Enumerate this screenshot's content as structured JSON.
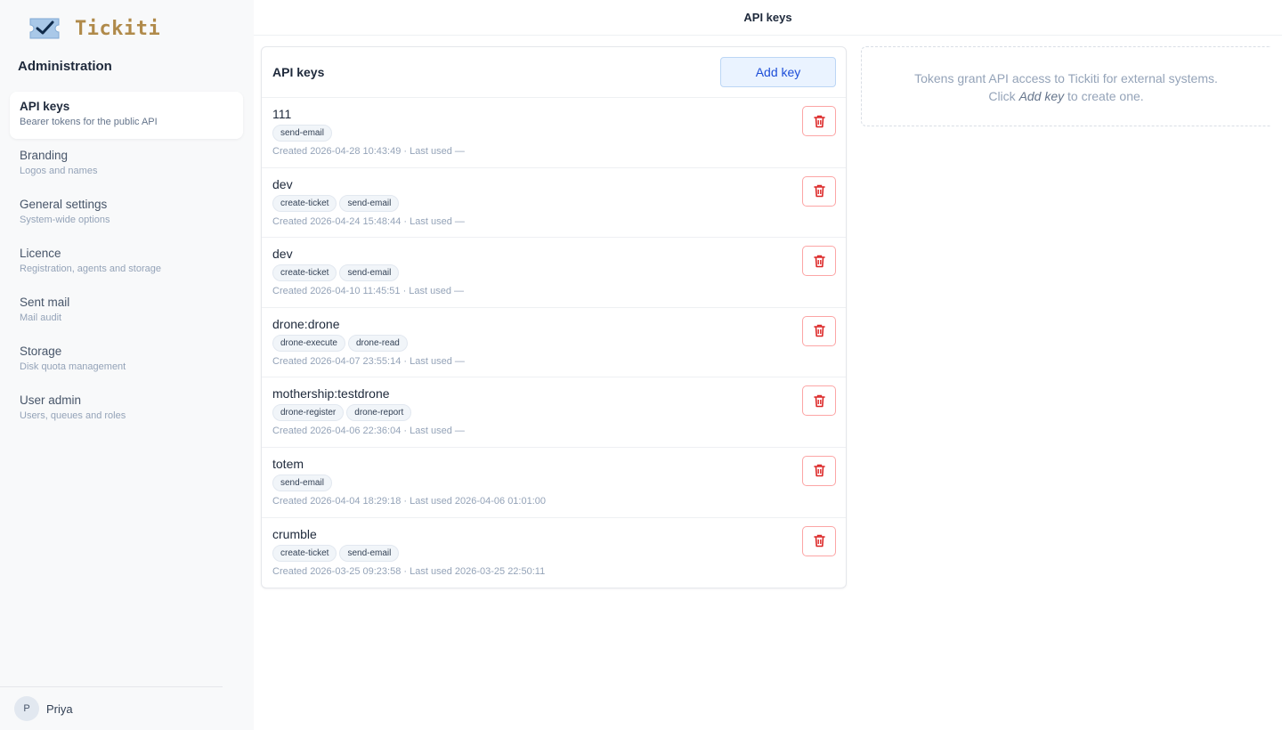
{
  "app": {
    "name": "Tickiti"
  },
  "sidebar": {
    "section_title": "Administration",
    "items": [
      {
        "label": "API keys",
        "sub": "Bearer tokens for the public API",
        "active": true
      },
      {
        "label": "Branding",
        "sub": "Logos and names"
      },
      {
        "label": "General settings",
        "sub": "System-wide options"
      },
      {
        "label": "Licence",
        "sub": "Registration, agents and storage"
      },
      {
        "label": "Sent mail",
        "sub": "Mail audit"
      },
      {
        "label": "Storage",
        "sub": "Disk quota management"
      },
      {
        "label": "User admin",
        "sub": "Users, queues and roles"
      }
    ],
    "user": {
      "initial": "P",
      "name": "Priya"
    }
  },
  "topbar": {
    "title": "API keys"
  },
  "card": {
    "title": "API keys",
    "add_label": "Add key",
    "keys": [
      {
        "name": "111",
        "scopes": [
          "send-email"
        ],
        "meta": "Created 2026-04-28 10:43:49 · Last used —"
      },
      {
        "name": "dev",
        "scopes": [
          "create-ticket",
          "send-email"
        ],
        "meta": "Created 2026-04-24 15:48:44 · Last used —"
      },
      {
        "name": "dev",
        "scopes": [
          "create-ticket",
          "send-email"
        ],
        "meta": "Created 2026-04-10 11:45:51 · Last used —"
      },
      {
        "name": "drone:drone",
        "scopes": [
          "drone-execute",
          "drone-read"
        ],
        "meta": "Created 2026-04-07 23:55:14 · Last used —"
      },
      {
        "name": "mothership:testdrone",
        "scopes": [
          "drone-register",
          "drone-report"
        ],
        "meta": "Created 2026-04-06 22:36:04 · Last used —"
      },
      {
        "name": "totem",
        "scopes": [
          "send-email"
        ],
        "meta": "Created 2026-04-04 18:29:18 · Last used 2026-04-06 01:01:00"
      },
      {
        "name": "crumble",
        "scopes": [
          "create-ticket",
          "send-email"
        ],
        "meta": "Created 2026-03-25 09:23:58 · Last used 2026-03-25 22:50:11"
      }
    ]
  },
  "hint": {
    "line1": "Tokens grant API access to Tickiti for external systems.",
    "line2_before": "Click ",
    "line2_em": "Add key",
    "line2_after": " to create one."
  },
  "colors": {
    "brand": "#b08a4a",
    "accent": "#1d4ed8",
    "danger": "#dc2626",
    "logo_ticket": "#a9c8e8"
  },
  "icons": {
    "logo": "ticket-check-icon",
    "delete": "trash-icon"
  }
}
